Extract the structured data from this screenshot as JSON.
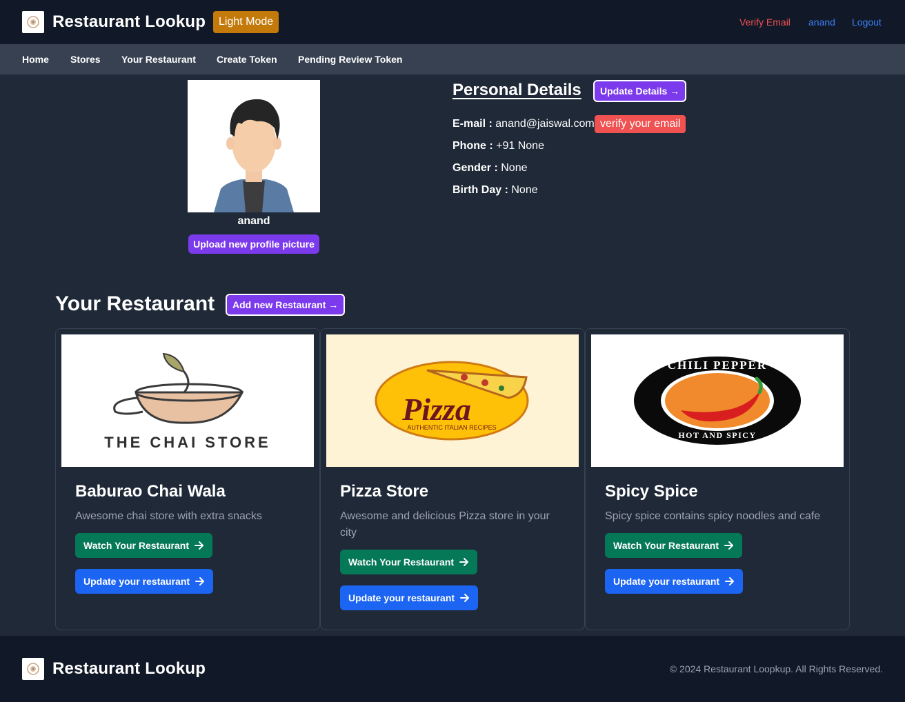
{
  "header": {
    "brand": "Restaurant Lookup",
    "mode_button": "Light Mode",
    "verify_email": "Verify Email",
    "username": "anand",
    "logout": "Logout"
  },
  "nav": [
    "Home",
    "Stores",
    "Your Restaurant",
    "Create Token",
    "Pending Review Token"
  ],
  "profile": {
    "username": "anand",
    "upload_button": "Upload new profile picture",
    "details_title": "Personal Details",
    "update_button": "Update Details →",
    "email_label": "E-mail :",
    "email_value": "anand@jaiswal.com",
    "verify_badge": "verify your email",
    "phone_label": "Phone :",
    "phone_value": "+91 None",
    "gender_label": "Gender :",
    "gender_value": "None",
    "birthday_label": "Birth Day :",
    "birthday_value": "None"
  },
  "restaurants_section": {
    "title": "Your Restaurant",
    "add_button": "Add new Restaurant →"
  },
  "restaurants": [
    {
      "name": "Baburao Chai Wala",
      "description": "Awesome chai store with extra snacks",
      "image_text": "THE CHAI STORE",
      "watch_button": "Watch Your Restaurant",
      "update_button": "Update your restaurant"
    },
    {
      "name": "Pizza Store",
      "description": "Awesome and delicious Pizza store in your city",
      "image_text": "Pizza",
      "image_subtext": "AUTHENTIC ITALIAN RECIPES",
      "watch_button": "Watch Your Restaurant",
      "update_button": "Update your restaurant"
    },
    {
      "name": "Spicy Spice",
      "description": "Spicy spice contains spicy noodles and cafe",
      "image_text": "CHILI PEPPER",
      "image_subtext": "HOT AND SPICY",
      "watch_button": "Watch Your Restaurant",
      "update_button": "Update your restaurant"
    }
  ],
  "footer": {
    "brand": "Restaurant Lookup",
    "copyright": "© 2024 Restaurant Loopkup. All Rights Reserved."
  },
  "colors": {
    "background": "#1f2937",
    "header": "#111827",
    "subnav": "#374151",
    "purple": "#7c3aed",
    "green": "#047857",
    "blue": "#1c64f2",
    "red": "#f05252",
    "amber": "#c47a0a"
  }
}
